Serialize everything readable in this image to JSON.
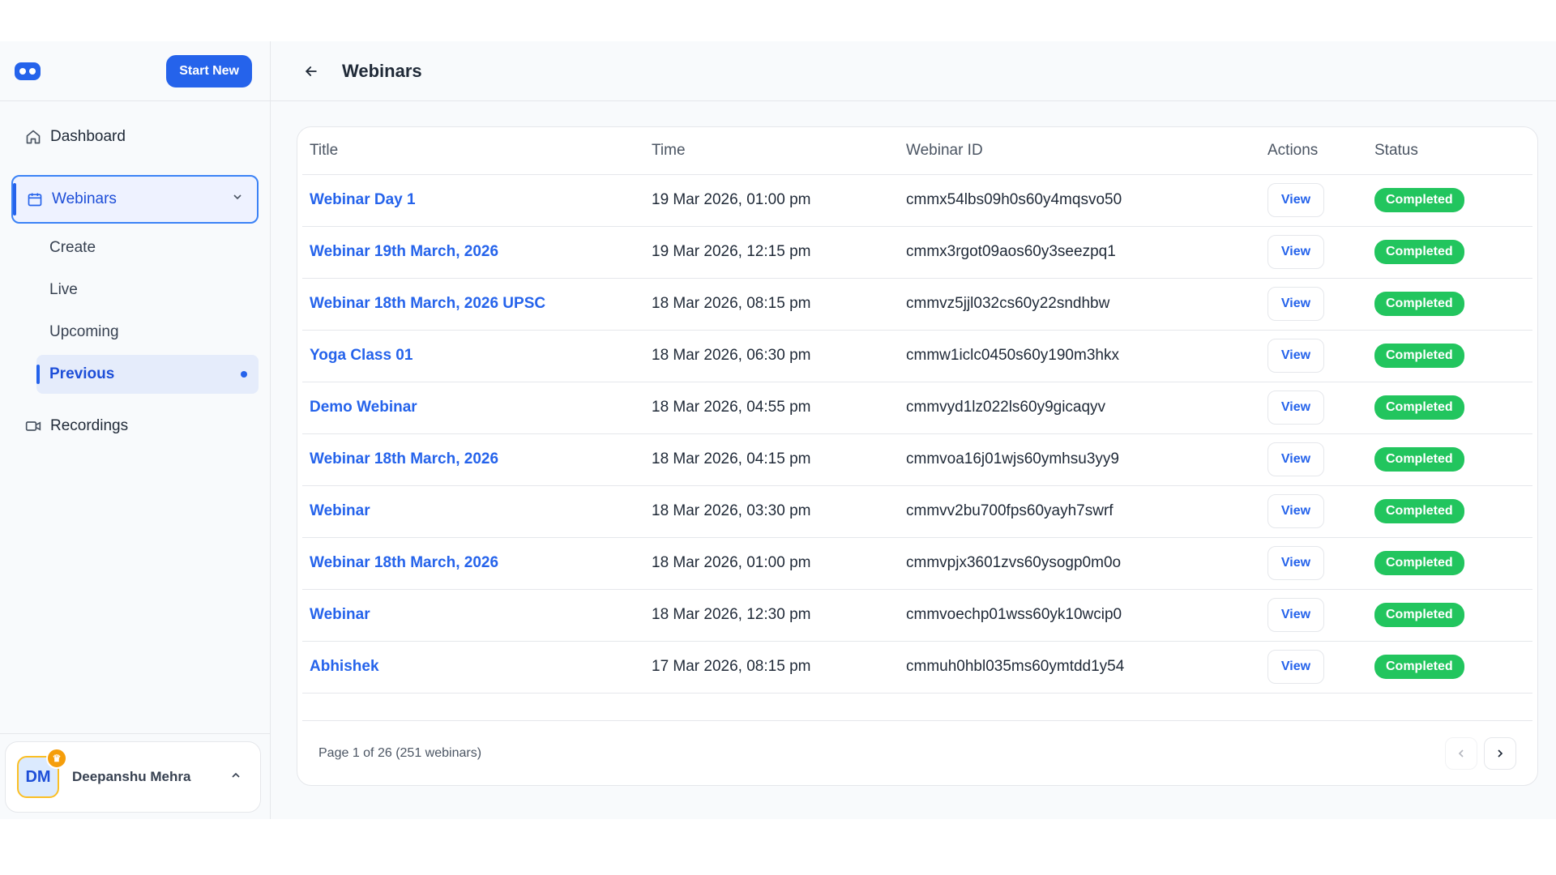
{
  "sidebar": {
    "start_new_label": "Start New",
    "nav": {
      "dashboard": "Dashboard",
      "webinars": "Webinars",
      "recordings": "Recordings"
    },
    "sub_items": [
      "Create",
      "Live",
      "Upcoming",
      "Previous"
    ],
    "active_sub": "Previous",
    "user": {
      "initials": "DM",
      "name": "Deepanshu Mehra"
    }
  },
  "header": {
    "title": "Webinars"
  },
  "table": {
    "headers": {
      "title": "Title",
      "time": "Time",
      "id": "Webinar ID",
      "actions": "Actions",
      "status": "Status"
    },
    "rows": [
      {
        "title": "Webinar Day 1",
        "time": "19 Mar 2026, 01:00 pm",
        "id": "cmmx54lbs09h0s60y4mqsvo50",
        "action": "View",
        "status": "Completed"
      },
      {
        "title": "Webinar 19th March, 2026",
        "time": "19 Mar 2026, 12:15 pm",
        "id": "cmmx3rgot09aos60y3seezpq1",
        "action": "View",
        "status": "Completed"
      },
      {
        "title": "Webinar 18th March, 2026 UPSC",
        "time": "18 Mar 2026, 08:15 pm",
        "id": "cmmvz5jjl032cs60y22sndhbw",
        "action": "View",
        "status": "Completed"
      },
      {
        "title": "Yoga Class 01",
        "time": "18 Mar 2026, 06:30 pm",
        "id": "cmmw1iclc0450s60y190m3hkx",
        "action": "View",
        "status": "Completed"
      },
      {
        "title": "Demo Webinar",
        "time": "18 Mar 2026, 04:55 pm",
        "id": "cmmvyd1lz022ls60y9gicaqyv",
        "action": "View",
        "status": "Completed"
      },
      {
        "title": "Webinar 18th March, 2026",
        "time": "18 Mar 2026, 04:15 pm",
        "id": "cmmvoa16j01wjs60ymhsu3yy9",
        "action": "View",
        "status": "Completed"
      },
      {
        "title": "Webinar",
        "time": "18 Mar 2026, 03:30 pm",
        "id": "cmmvv2bu700fps60yayh7swrf",
        "action": "View",
        "status": "Completed"
      },
      {
        "title": "Webinar 18th March, 2026",
        "time": "18 Mar 2026, 01:00 pm",
        "id": "cmmvpjx3601zvs60ysogp0m0o",
        "action": "View",
        "status": "Completed"
      },
      {
        "title": "Webinar",
        "time": "18 Mar 2026, 12:30 pm",
        "id": "cmmvoechp01wss60yk10wcip0",
        "action": "View",
        "status": "Completed"
      },
      {
        "title": "Abhishek",
        "time": "17 Mar 2026, 08:15 pm",
        "id": "cmmuh0hbl035ms60ymtdd1y54",
        "action": "View",
        "status": "Completed"
      }
    ]
  },
  "pagination": {
    "info": "Page 1 of 26 (251 webinars)"
  },
  "colors": {
    "accent": "#2563eb",
    "status_completed": "#22c55e"
  },
  "icons": [
    "logo-icon",
    "home-icon",
    "calendar-icon",
    "chevron-down-icon",
    "video-icon",
    "crown-icon",
    "chevron-up-icon",
    "arrow-left-icon",
    "chevron-left-icon",
    "chevron-right-icon"
  ]
}
